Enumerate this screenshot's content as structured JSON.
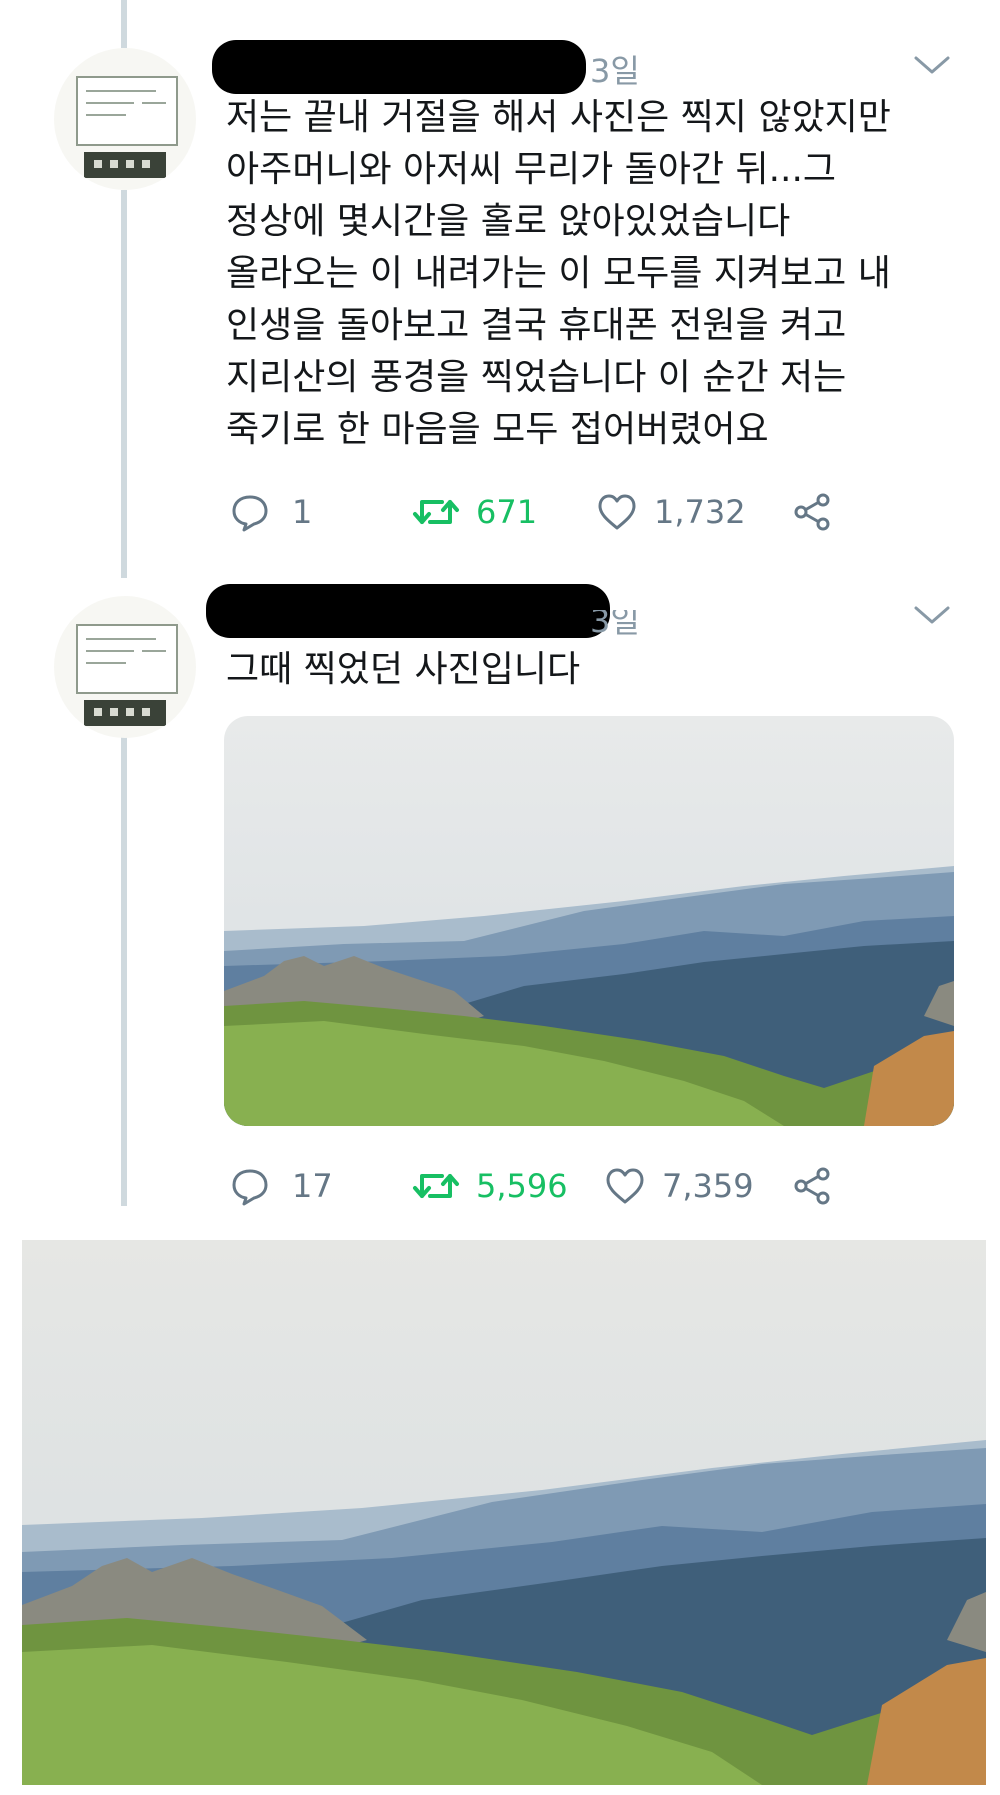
{
  "tweets": [
    {
      "date": "3일",
      "lines": [
        "저는 끝내 거절을 해서 사진은 찍지 않았지만",
        "아주머니와 아저씨 무리가 돌아간 뒤...그",
        "정상에 몇시간을 홀로 앉아있었습니다",
        "올라오는 이 내려가는 이 모두를 지켜보고 내",
        "인생을 돌아보고 결국 휴대폰 전원을 켜고",
        "지리산의 풍경을 찍었습니다 이 순간 저는",
        "죽기로 한 마음을 모두 접어버렸어요"
      ],
      "replies": "1",
      "retweets": "671",
      "likes": "1,732"
    },
    {
      "date": "3일",
      "lines": [
        "그때 찍었던 사진입니다"
      ],
      "replies": "17",
      "retweets": "5,596",
      "likes": "7,359"
    }
  ],
  "icons": {
    "reply": "reply-icon",
    "retweet": "retweet-icon",
    "like": "heart-icon",
    "share": "share-icon",
    "menu": "chevron-down-icon"
  },
  "colors": {
    "retweet": "#17bf63",
    "muted": "#657786",
    "thread_line": "#cfd9de",
    "redaction": "#000000"
  }
}
